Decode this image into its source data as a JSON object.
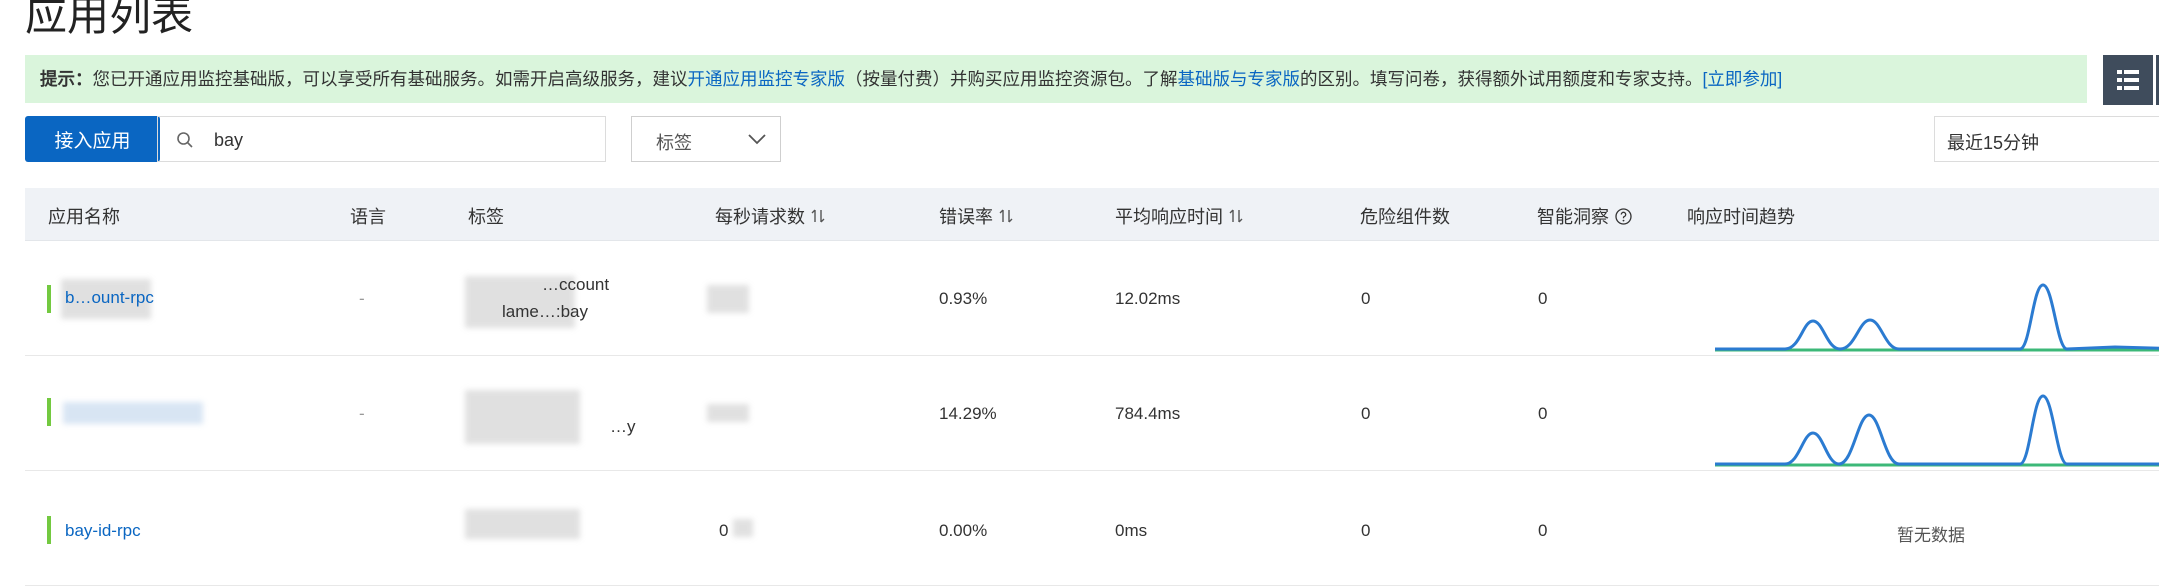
{
  "page_title": "应用列表",
  "notice": {
    "prefix": "提示：",
    "text1": "您已开通应用监控基础版，可以享受所有基础服务。如需开启高级服务，建议",
    "link1": "开通应用监控专家版",
    "text2": "（按量付费）并购买应用监控资源包。了解",
    "link2": "基础版与专家版",
    "text3": "的区别。填写问卷，获得额外试用额度和专家支持。",
    "link3": "[立即参加]"
  },
  "toolbar": {
    "add_app_label": "接入应用",
    "search_value": "bay",
    "tag_select_label": "标签",
    "time_range_label": "最近15分钟"
  },
  "table": {
    "columns": {
      "name": "应用名称",
      "language": "语言",
      "tags": "标签",
      "rps": "每秒请求数",
      "error_rate": "错误率",
      "avg_rt": "平均响应时间",
      "risk": "危险组件数",
      "insight": "智能洞察",
      "trend": "响应时间趋势"
    },
    "rows": [
      {
        "name": "b…ount-rpc",
        "language": "-",
        "tag_line1": "…ccount",
        "tag_line2": "lame…:bay",
        "error_rate": "0.93%",
        "avg_rt": "12.02ms",
        "risk": "0",
        "insight": "0"
      },
      {
        "name": "",
        "language": "-",
        "tag_line1": "",
        "tag_line2": "…y",
        "error_rate": "14.29%",
        "avg_rt": "784.4ms",
        "risk": "0",
        "insight": "0"
      },
      {
        "name": "bay-id-rpc",
        "language": "",
        "tag_line1": "",
        "tag_line2": "",
        "rps": "0",
        "error_rate": "0.00%",
        "avg_rt": "0ms",
        "risk": "0",
        "insight": "0",
        "trend_text": "暂无数据"
      }
    ]
  },
  "colors": {
    "primary": "#0a66c2",
    "notice_bg": "#daf5dc",
    "trend_blue": "#2b7bd1",
    "trend_green": "#3cb878",
    "accent_bar": "#73c940"
  },
  "icons": {
    "search": "search-icon",
    "select": "chevron-down-icon",
    "list": "list-icon",
    "help": "question-circle-icon",
    "sort": "sort-icon"
  }
}
